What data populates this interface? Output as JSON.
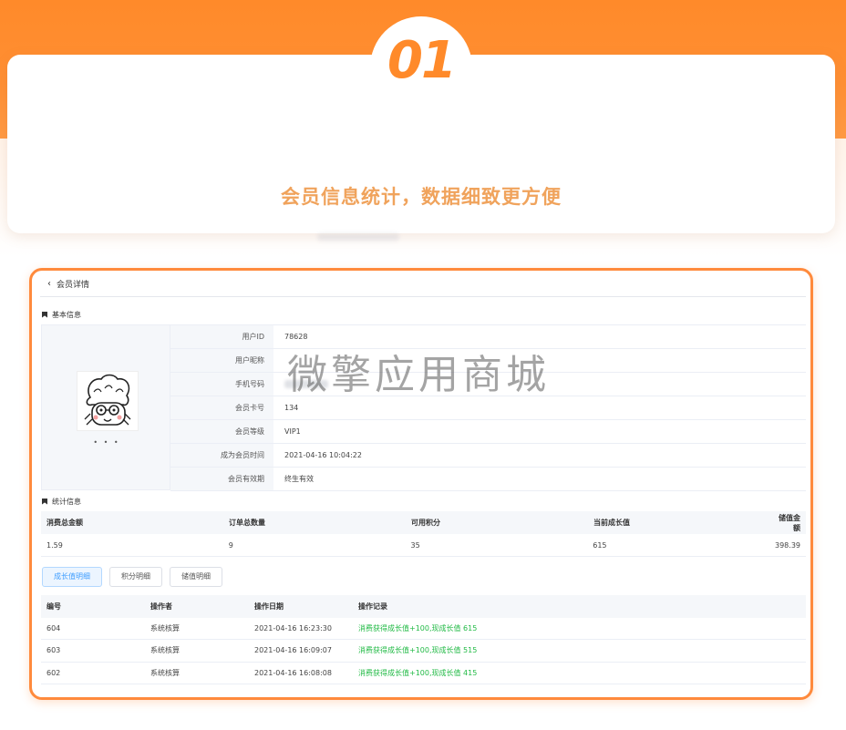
{
  "hero": {
    "number": "01",
    "title": "会员信息统计，数据细致更方便",
    "accent": "#ff8a2a"
  },
  "page": {
    "back_label": "会员详情",
    "watermark": "微擎应用商城"
  },
  "basic": {
    "section_title": "基本信息",
    "nickname_display": "• • •",
    "rows": [
      {
        "label": "用户ID",
        "value": "78628"
      },
      {
        "label": "用户昵称",
        "value": ""
      },
      {
        "label": "手机号码",
        "value": ""
      },
      {
        "label": "会员卡号",
        "value": "134"
      },
      {
        "label": "会员等级",
        "value": "VIP1"
      },
      {
        "label": "成为会员时间",
        "value": "2021-04-16 10:04:22"
      },
      {
        "label": "会员有效期",
        "value": "终生有效"
      }
    ]
  },
  "stats": {
    "section_title": "统计信息",
    "headers": [
      "消费总金额",
      "订单总数量",
      "可用积分",
      "当前成长值",
      "储值金额"
    ],
    "values": [
      "1.59",
      "9",
      "35",
      "615",
      "398.39"
    ]
  },
  "tabs": [
    "成长值明细",
    "积分明细",
    "储值明细"
  ],
  "log": {
    "headers": [
      "编号",
      "操作者",
      "操作日期",
      "操作记录"
    ],
    "rows": [
      {
        "id": "604",
        "operator": "系统核算",
        "date": "2021-04-16 16:23:30",
        "record": "消费获得成长值+100,现成长值 615"
      },
      {
        "id": "603",
        "operator": "系统核算",
        "date": "2021-04-16 16:09:07",
        "record": "消费获得成长值+100,现成长值 515"
      },
      {
        "id": "602",
        "operator": "系统核算",
        "date": "2021-04-16 16:08:08",
        "record": "消费获得成长值+100,现成长值 415"
      }
    ]
  }
}
